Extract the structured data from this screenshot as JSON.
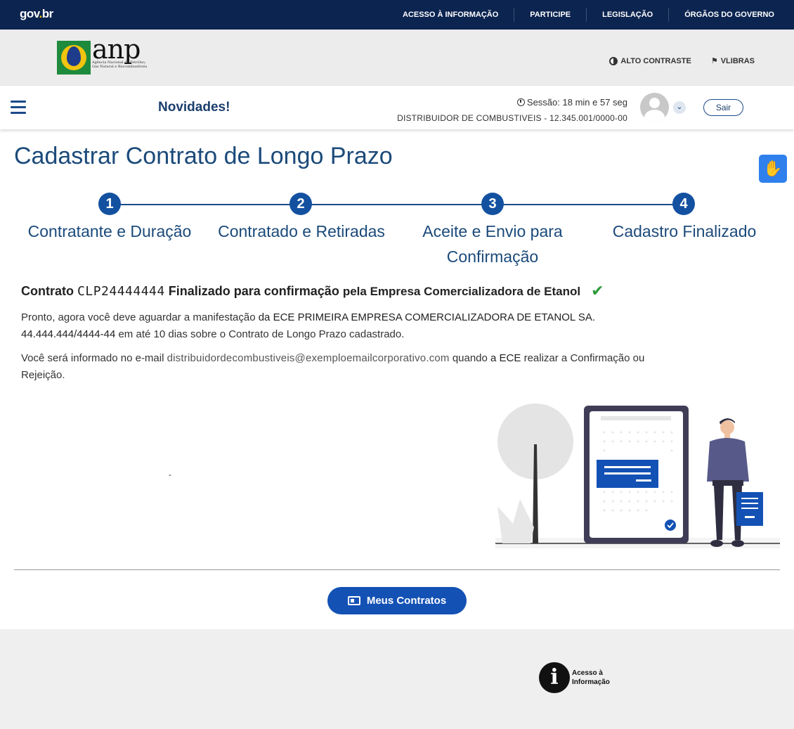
{
  "govbar": {
    "logo_main": "gov",
    "logo_dot": ".",
    "logo_end": "br",
    "links": [
      "ACESSO À INFORMAÇÃO",
      "PARTICIPE",
      "LEGISLAÇÃO",
      "ÓRGÃOS DO GOVERNO"
    ]
  },
  "header": {
    "logo_text": "anp",
    "logo_sub": "Agência Nacional do Petróleo, Gás Natural e Biocombustíveis",
    "alto_contraste": "ALTO CONTRASTE",
    "vlibras": "VLIBRAS"
  },
  "nav": {
    "novidades": "Novidades!",
    "session": "Sessão: 18 min e 57 seg",
    "user_company": "DISTRIBUIDOR DE COMBUSTIVEIS - 12.345.001/0000-00",
    "sair": "Sair"
  },
  "page": {
    "title": "Cadastrar Contrato de Longo Prazo"
  },
  "steps": [
    {
      "num": "1",
      "label": "Contratante e Duração"
    },
    {
      "num": "2",
      "label": "Contratado e Retiradas"
    },
    {
      "num": "3",
      "label": "Aceite e Envio para Confirmação"
    },
    {
      "num": "4",
      "label": "Cadastro Finalizado"
    }
  ],
  "result": {
    "contrato_word": "Contrato",
    "code": "CLP24444444",
    "finalized": "Finalizado para confirmação",
    "by_company": "pela Empresa Comercializadora de Etanol",
    "p1_a": "Pronto, agora você deve aguardar a manifestação",
    "p1_b": "da ECE PRIMEIRA EMPRESA COMERCIALIZADORA DE ETANOL SA.",
    "p1_cnpj": "44.444.444/4444-44",
    "p1_c": "em até 10 dias sobre o Contrato de Longo Prazo cadastrado.",
    "p2_a": "Você será informado no e-mail",
    "p2_email": "distribuidordecombustiveis@exemploemailcorporativo.com",
    "p2_b": "quando",
    "p2_c": "a ECE",
    "p2_d": "realizar a Confirmação ou",
    "p2_e": "Rejeição.",
    "dash": "-"
  },
  "actions": {
    "meus_contratos": "Meus Contratos"
  },
  "footer": {
    "acesso_line1": "Acesso à",
    "acesso_line2": "Informação"
  },
  "colors": {
    "govbar_bg": "#0c2450",
    "primary": "#1351b4",
    "title": "#1b4a7a",
    "success": "#2e9a3a"
  }
}
